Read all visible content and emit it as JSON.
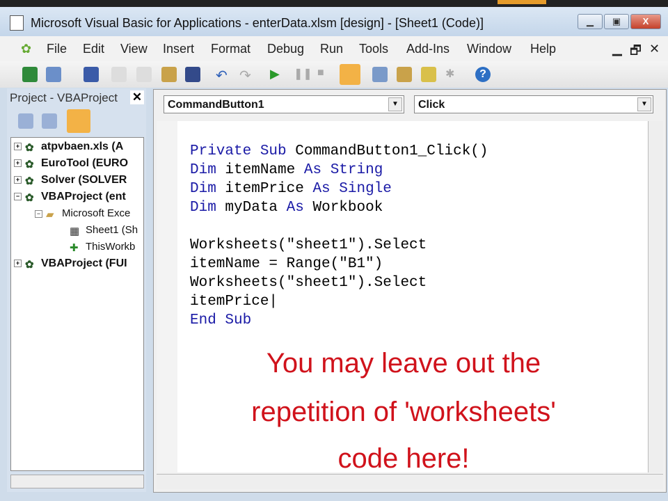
{
  "window": {
    "title": "Microsoft Visual Basic for Applications - enterData.xlsm [design] - [Sheet1 (Code)]"
  },
  "menu": [
    "File",
    "Edit",
    "View",
    "Insert",
    "Format",
    "Debug",
    "Run",
    "Tools",
    "Add-Ins",
    "Window",
    "Help"
  ],
  "project": {
    "title": "Project - VBAProject",
    "close": "✕",
    "nodes": [
      "atpvbaen.xls (A",
      "EuroTool (EURO",
      "Solver (SOLVER",
      "VBAProject (ent",
      "Microsoft Exce",
      "Sheet1 (Sh",
      "ThisWorkb",
      "VBAProject (FUI"
    ]
  },
  "code": {
    "object": "CommandButton1",
    "procedure": "Click",
    "lines": [
      "Private Sub CommandButton1_Click()",
      "Dim itemName As String",
      "Dim itemPrice As Single",
      "Dim myData As Workbook",
      "",
      "Worksheets(\"sheet1\").Select",
      "itemName = Range(\"B1\")",
      "Worksheets(\"sheet1\").Select",
      "itemPrice",
      "End Sub"
    ]
  },
  "annotation": [
    "You may leave out the",
    "repetition of 'worksheets'",
    "code here!"
  ]
}
